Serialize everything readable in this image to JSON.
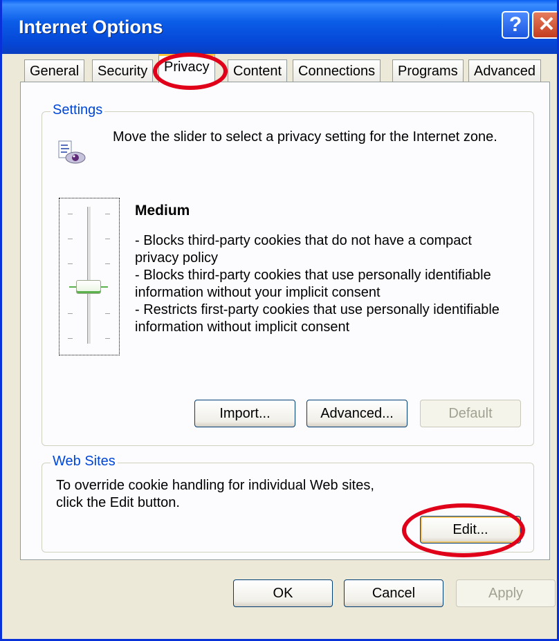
{
  "window": {
    "title": "Internet Options"
  },
  "titlebar": {
    "help_glyph": "?",
    "close_glyph": "✕"
  },
  "tabs": [
    {
      "label": "General"
    },
    {
      "label": "Security"
    },
    {
      "label": "Privacy"
    },
    {
      "label": "Content"
    },
    {
      "label": "Connections"
    },
    {
      "label": "Programs"
    },
    {
      "label": "Advanced"
    }
  ],
  "active_tab": "Privacy",
  "settings": {
    "legend": "Settings",
    "instruction": "Move the slider to select a privacy setting for the Internet zone.",
    "level_title": "Medium",
    "description_lines": [
      "- Blocks third-party cookies that do not have a compact",
      "privacy policy",
      "- Blocks third-party cookies that use personally identifiable",
      "information without your implicit consent",
      "- Restricts first-party cookies that use personally identifiable",
      "information without implicit consent"
    ],
    "slider": {
      "positions": 6,
      "selected_index": 3
    },
    "import_label": "Import...",
    "advanced_label": "Advanced...",
    "default_label": "Default"
  },
  "websites": {
    "legend": "Web Sites",
    "line1": "To override cookie handling for individual Web sites,",
    "line2": "click the Edit button.",
    "edit_label": "Edit..."
  },
  "footer": {
    "ok_label": "OK",
    "cancel_label": "Cancel",
    "apply_label": "Apply"
  },
  "colors": {
    "title_blue": "#0a5ff0",
    "legend_blue": "#0046d5",
    "highlight_red": "#e0001a",
    "active_tab_accent": "#ffc73c"
  },
  "icons": {
    "privacy": "privacy-eye-icon"
  }
}
